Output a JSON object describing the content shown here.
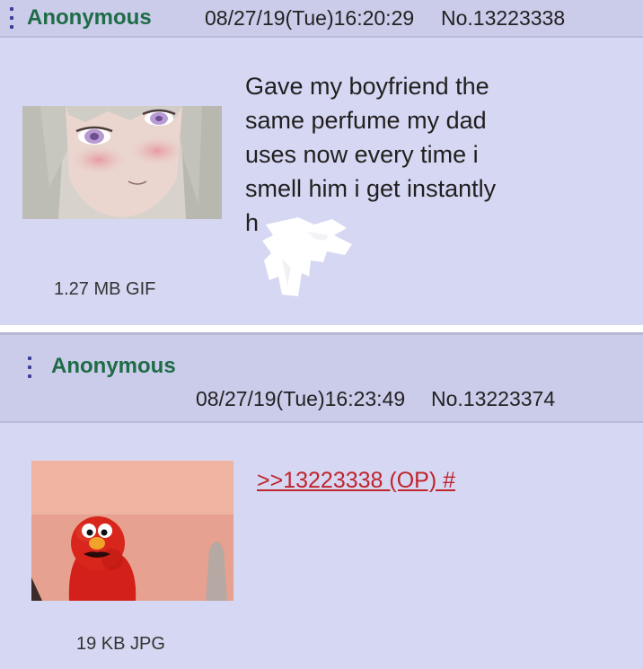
{
  "posts": [
    {
      "name": "Anonymous",
      "datetime": "08/27/19(Tue)16:20:29",
      "number": "No.13223338",
      "file_info": "1.27 MB GIF",
      "comment_lines": [
        "Gave my boyfriend the",
        "same perfume my dad",
        "uses now every time i",
        "smell him i get instantly",
        "h"
      ]
    },
    {
      "name": "Anonymous",
      "datetime": "08/27/19(Tue)16:23:49",
      "number": "No.13223374",
      "file_info": "19 KB JPG",
      "quote": ">>13223338 (OP) #"
    }
  ],
  "colors": {
    "background": "#d6d7f2",
    "header": "#cbcbea",
    "name": "#1d6c45",
    "quote_link": "#c0242c",
    "menu_icon": "#3b3f9a"
  },
  "icons": [
    "post-menu-icon"
  ]
}
